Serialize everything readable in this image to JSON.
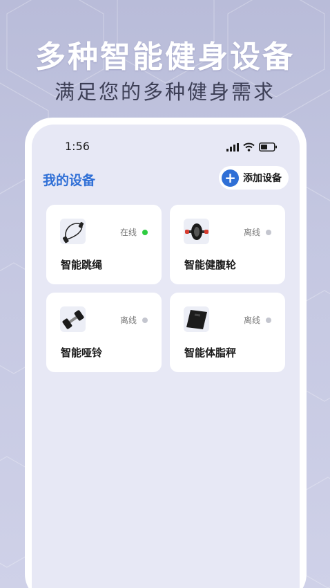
{
  "promo": {
    "headline": "多种智能健身设备",
    "subline": "满足您的多种健身需求"
  },
  "status_bar": {
    "time": "1:56",
    "icons": [
      "signal-icon",
      "wifi-icon",
      "battery-icon"
    ]
  },
  "header": {
    "title": "我的设备",
    "add_label": "添加设备"
  },
  "devices": [
    {
      "name": "智能跳绳",
      "status": "在线",
      "icon": "jump-rope-icon",
      "status_color": "#2ecc40"
    },
    {
      "name": "智能健腹轮",
      "status": "离线",
      "icon": "ab-wheel-icon",
      "status_color": "#c4c6cf"
    },
    {
      "name": "智能哑铃",
      "status": "离线",
      "icon": "dumbbell-icon",
      "status_color": "#c4c6cf"
    },
    {
      "name": "智能体脂秤",
      "status": "离线",
      "icon": "scale-icon",
      "status_color": "#c4c6cf"
    }
  ],
  "colors": {
    "accent": "#2f6fd6",
    "online": "#2ecc40",
    "offline": "#c4c6cf"
  }
}
